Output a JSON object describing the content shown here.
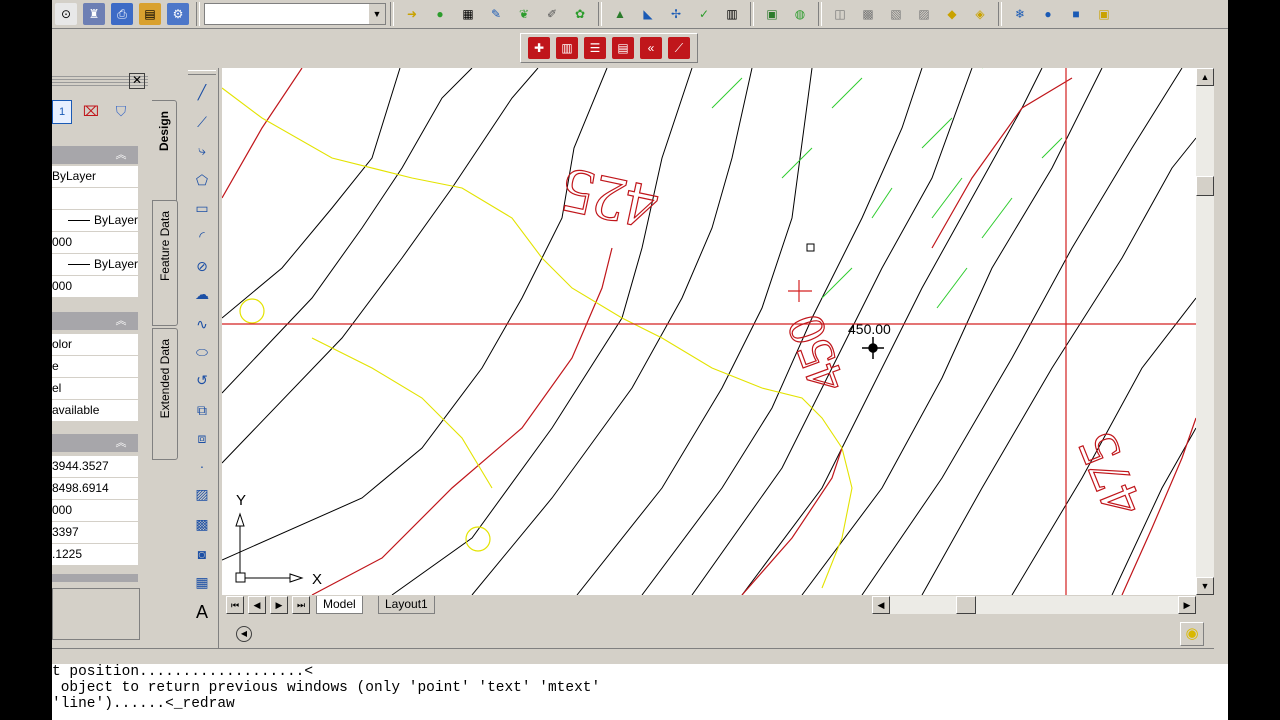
{
  "colors": {
    "contour": "#000000",
    "index_contour": "#c0161b",
    "highlight": "#e3e300",
    "green": "#2ecc2e",
    "crosshair": "#d32020"
  },
  "toolbar": {
    "icons_top": [
      "snap-icon",
      "attr-icon",
      "plot-icon",
      "folder-icon",
      "tool-icon",
      "spacer",
      "arrow-icon",
      "ball-icon",
      "film-icon",
      "brush-icon",
      "leaf-icon",
      "pen-icon",
      "text-icon",
      "mountain-icon",
      "scale-icon",
      "zoom-icon",
      "hatch-icon",
      "layers-icon",
      "paint-icon",
      "stack-icon",
      "grid-icon",
      "grid2-icon",
      "vcr-icon",
      "snowflake-icon",
      "bulb-icon",
      "lock-icon",
      "unlock-icon"
    ],
    "icons_second": [
      "red-cross-icon",
      "red-bars-icon",
      "red-list-icon",
      "red-table-icon",
      "red-gear-icon",
      "red-line-icon"
    ]
  },
  "properties": {
    "general": {
      "color_value": "ByLayer",
      "linetype_value": "ByLayer",
      "lt_scale": "000",
      "lineweight_value": "ByLayer",
      "thickness": "000"
    },
    "plot": {
      "plot_style": "olor",
      "plot_style_table": "e",
      "attached_to": "el",
      "paper_space": "available"
    },
    "view": {
      "center_x": "3944.3527",
      "center_y": "8498.6914",
      "center_z": "000",
      "height": "3397",
      "width": ".1225"
    },
    "tabs": {
      "design": "Design",
      "feature": "Feature Data",
      "extended": "Extended Data"
    }
  },
  "drawing": {
    "contour_labels": [
      "425",
      "450",
      "475"
    ],
    "point_label": "450.00",
    "ucs_y": "Y",
    "ucs_x": "X"
  },
  "layout_tabs": [
    "Model",
    "Layout1"
  ],
  "command_lines": [
    "t position...................<",
    " object to return previous windows (only 'point' 'text' 'mtext'",
    "'line')......<_redraw"
  ]
}
